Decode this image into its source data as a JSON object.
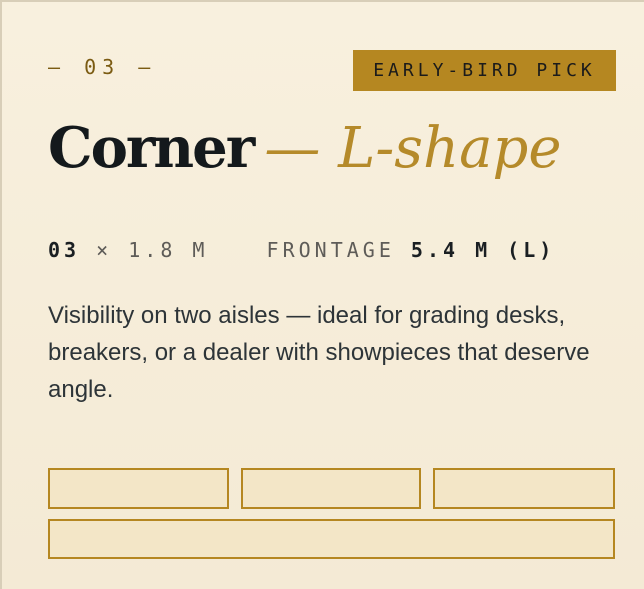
{
  "card": {
    "index_label": "— 03 —",
    "badge": "EARLY-BIRD PICK",
    "title_main": "Corner",
    "title_sub": "— L-shape",
    "specs": {
      "size_prefix": "03",
      "size_times": "×",
      "size_length": "1.8 M",
      "frontage_label": "FRONTAGE",
      "frontage_value": "5.4 M (L)"
    },
    "description": "Visibility on two aisles — ideal for grading desks, breakers, or a dealer with showpieces that deserve angle."
  },
  "inputs": [
    {
      "value": "",
      "placeholder": ""
    },
    {
      "value": "",
      "placeholder": ""
    },
    {
      "value": "",
      "placeholder": ""
    },
    {
      "value": "",
      "placeholder": ""
    }
  ],
  "colors": {
    "background": "#f7eedb",
    "accent": "#b58721",
    "title": "#14191c",
    "subtitle": "#b58a2a",
    "text": "#2d3438"
  },
  "icons": []
}
